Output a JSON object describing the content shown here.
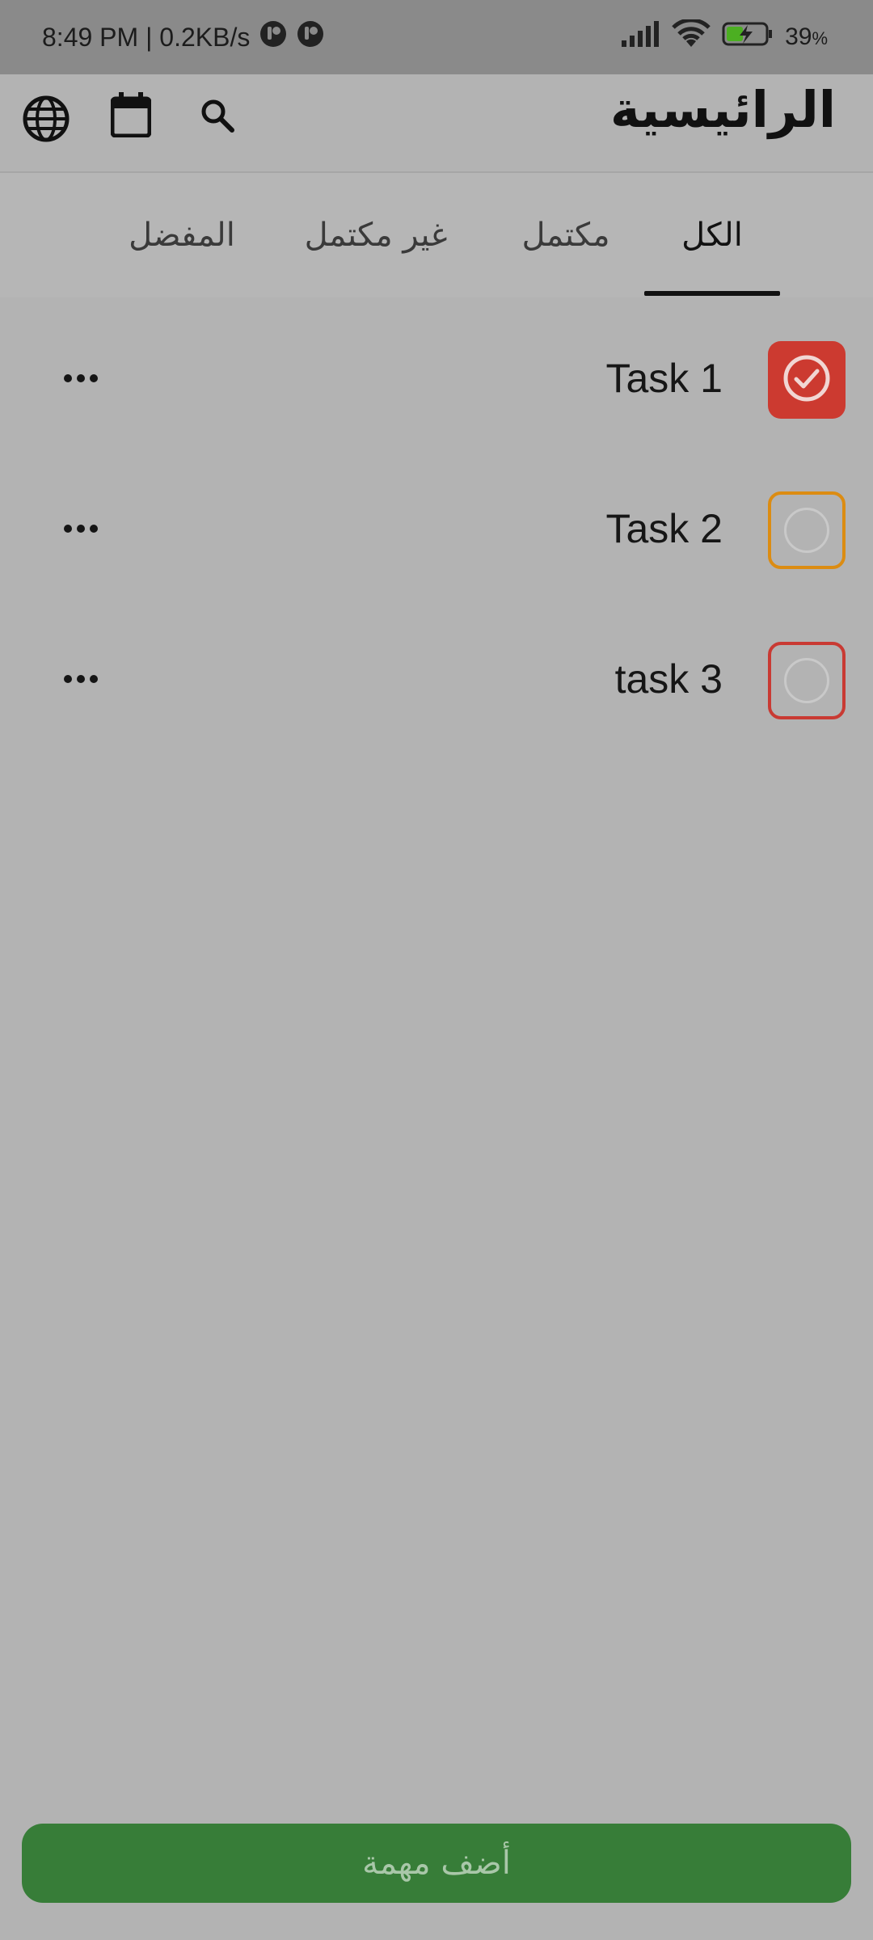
{
  "status_bar": {
    "time_and_speed": "8:49 PM | 0.2KB/s",
    "battery": "39",
    "battery_unit": "%"
  },
  "header": {
    "title": "الرائيسية",
    "icons": [
      "globe-icon",
      "calendar-icon",
      "search-icon"
    ]
  },
  "tabs": [
    {
      "label": "الكل",
      "active": true
    },
    {
      "label": "مكتمل",
      "active": false
    },
    {
      "label": "غير مكتمل",
      "active": false
    },
    {
      "label": "المفضل",
      "active": false
    }
  ],
  "tasks": [
    {
      "title": "Task 1",
      "completed": true,
      "color": "#cc3a30"
    },
    {
      "title": "Task 2",
      "completed": false,
      "color": "#dc8c12"
    },
    {
      "title": "task 3",
      "completed": false,
      "color": "#c93a33"
    }
  ],
  "add_button": {
    "label": "أضف مهمة",
    "color": "#377d38"
  }
}
